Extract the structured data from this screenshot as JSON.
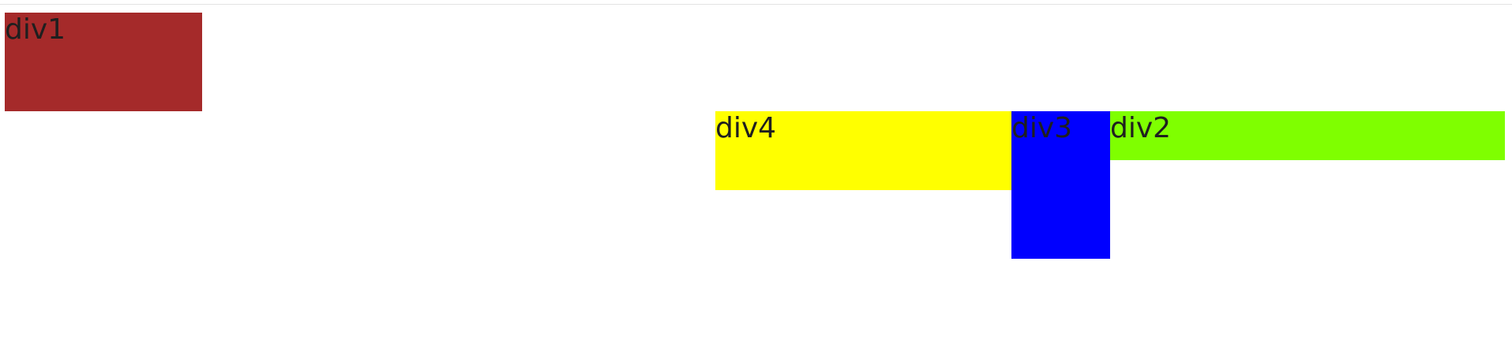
{
  "boxes": {
    "div1": {
      "label": "div1",
      "color": "#a52a2a"
    },
    "div2": {
      "label": "div2",
      "color": "#7fff00"
    },
    "div3": {
      "label": "div3",
      "color": "#0000ff"
    },
    "div4": {
      "label": "div4",
      "color": "#ffff00"
    }
  }
}
